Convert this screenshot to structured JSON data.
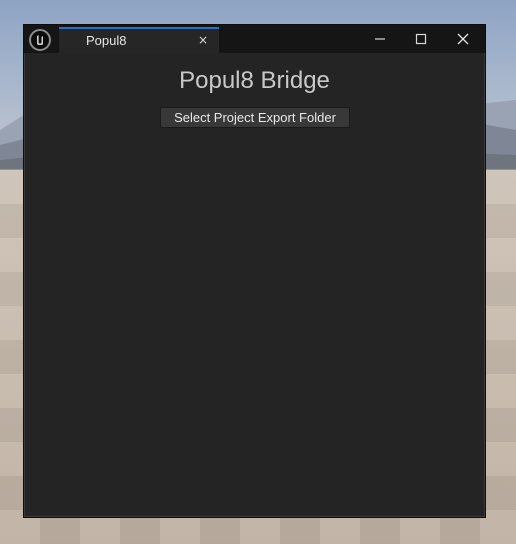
{
  "window": {
    "tab_label": "Popul8",
    "tab_close_glyph": "×",
    "controls": {
      "minimize_icon": "minimize-icon",
      "maximize_icon": "maximize-icon",
      "close_icon": "close-icon"
    },
    "logo_icon": "unreal-engine-logo-icon"
  },
  "main": {
    "title": "Popul8 Bridge",
    "select_folder_label": "Select Project Export Folder"
  },
  "colors": {
    "tab_accent": "#2b6fc7",
    "window_bg": "#242424",
    "titlebar_bg": "#151515",
    "button_bg": "#383838"
  }
}
